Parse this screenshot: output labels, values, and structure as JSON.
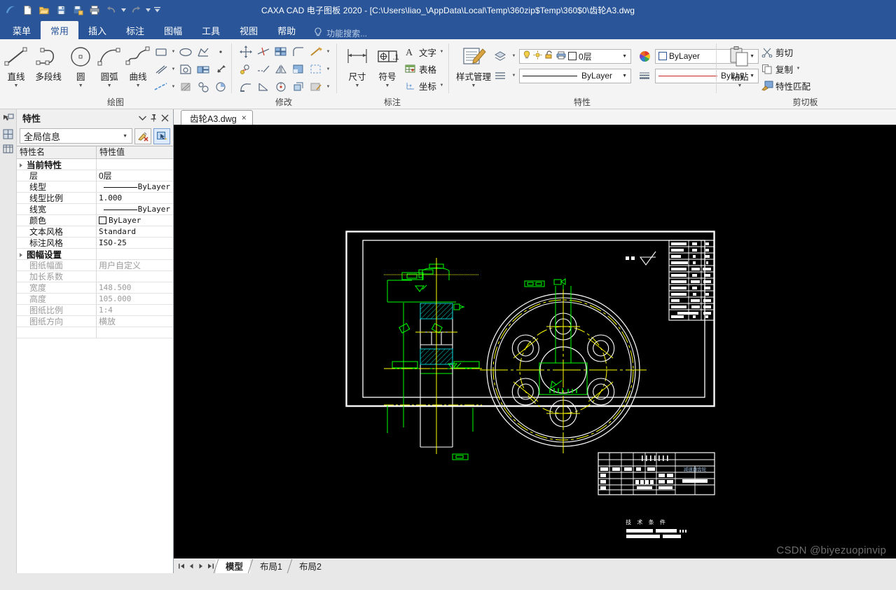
{
  "app": {
    "title": "CAXA CAD 电子图板 2020 - [C:\\Users\\liao_\\AppData\\Local\\Temp\\360zip$Temp\\360$0\\齿轮A3.dwg",
    "accent": "#2a5699",
    "ribbon_bg": "#f4f4f4",
    "canvas_bg": "#000000"
  },
  "quick_access": [
    {
      "name": "new-file-icon",
      "label": "新建"
    },
    {
      "name": "open-file-icon",
      "label": "打开"
    },
    {
      "name": "save-icon",
      "label": "保存"
    },
    {
      "name": "save-as-icon",
      "label": "另存为"
    },
    {
      "name": "print-icon",
      "label": "打印"
    },
    {
      "name": "undo-icon",
      "label": "撤销"
    },
    {
      "name": "redo-icon",
      "label": "恢复"
    },
    {
      "name": "customize-qat-icon",
      "label": "自定义快速启动工具栏"
    }
  ],
  "ribbon_tabs": [
    {
      "label": "菜单",
      "active": false
    },
    {
      "label": "常用",
      "active": true
    },
    {
      "label": "插入",
      "active": false
    },
    {
      "label": "标注",
      "active": false
    },
    {
      "label": "图幅",
      "active": false
    },
    {
      "label": "工具",
      "active": false
    },
    {
      "label": "视图",
      "active": false
    },
    {
      "label": "帮助",
      "active": false
    }
  ],
  "ribbon_search": {
    "placeholder": "功能搜索...",
    "icon": "lightbulb-icon"
  },
  "ribbon_groups": {
    "draw": {
      "title": "绘图",
      "big_buttons": [
        {
          "label": "直线",
          "icon": "line-icon",
          "has_caret": true
        },
        {
          "label": "多段线",
          "icon": "polyline-icon",
          "has_caret": false
        },
        {
          "label": "圆",
          "icon": "circle-icon",
          "has_caret": true
        },
        {
          "label": "圆弧",
          "icon": "arc-icon",
          "has_caret": true
        },
        {
          "label": "曲线",
          "icon": "spline-icon",
          "has_caret": true
        }
      ],
      "small_buttons": [
        "rectangle-icon",
        "ellipse-icon",
        "polygon-icon",
        "point-icon",
        "parallel-line-icon",
        "hatch-region-icon",
        "table-grid-icon",
        "arrow-icon",
        "centerline-icon",
        "hatch-icon",
        "puzzle-icon",
        "pie-icon"
      ]
    },
    "modify": {
      "title": "修改",
      "small_buttons": [
        "move-icon",
        "trim-icon",
        "array-icon",
        "fillet-icon",
        "explode-icon",
        "rotate-icon",
        "extend-icon",
        "mirror-icon",
        "chamfer-icon",
        "offset-icon",
        "stretch-icon",
        "break-icon",
        "scale-icon",
        "copy-3d-icon",
        "edit-hatch-icon"
      ]
    },
    "annotate": {
      "title": "标注",
      "big_buttons": [
        {
          "label": "尺寸",
          "icon": "dimension-icon",
          "has_caret": true
        },
        {
          "label": "符号",
          "icon": "symbol-icon",
          "has_caret": true
        }
      ],
      "text_buttons": [
        {
          "label": "文字",
          "icon": "text-a-icon",
          "has_caret": true
        },
        {
          "label": "表格",
          "icon": "table-icon",
          "has_caret": false
        },
        {
          "label": "坐标",
          "icon": "coordinate-icon",
          "has_caret": true
        }
      ]
    },
    "properties": {
      "title": "特性",
      "style_manager": {
        "label": "样式管理",
        "icon": "style-manager-icon",
        "has_caret": true
      },
      "layer_icon": "layer-icon",
      "linetype_icon": "linetype-list-icon",
      "color_wheel_icon": "color-wheel-icon",
      "lineweight_icon": "lineweight-icon",
      "layer_combo": {
        "value": "0层",
        "icons": [
          "bulb-icon",
          "sun-icon",
          "lock-icon",
          "printer-icon",
          "color-box-icon"
        ]
      },
      "color_combo": {
        "value": "ByLayer",
        "swatch": "#ffffff"
      },
      "linetype_combo": {
        "value": "ByLayer"
      },
      "lineweight_combo": {
        "value": "ByLay",
        "color": "#cc2222"
      }
    },
    "clipboard": {
      "title": "剪切板",
      "paste": {
        "label": "粘贴",
        "icon": "paste-icon",
        "has_caret": true
      },
      "items": [
        {
          "label": "剪切",
          "icon": "scissors-icon",
          "has_caret": false
        },
        {
          "label": "复制",
          "icon": "copy-icon",
          "has_caret": true
        },
        {
          "label": "特性匹配",
          "icon": "match-properties-icon",
          "has_caret": false
        }
      ]
    }
  },
  "vertical_strip": [
    "pick-tool-icon",
    "layer-tool-icon",
    "block-tool-icon"
  ],
  "properties_panel": {
    "title": "特性",
    "header_buttons": [
      "chevron-down-icon",
      "pin-icon",
      "close-icon"
    ],
    "filter": {
      "value": "全局信息"
    },
    "filter_buttons": [
      "clear-selection-icon",
      "select-objects-icon"
    ],
    "columns": {
      "name": "特性名",
      "value": "特性值"
    },
    "groups": [
      {
        "label": "当前特性",
        "dim": false,
        "rows": [
          {
            "name": "层",
            "value": "0层",
            "kind": "cn"
          },
          {
            "name": "线型",
            "value": "ByLayer",
            "kind": "line"
          },
          {
            "name": "线型比例",
            "value": "1.000",
            "kind": "mono"
          },
          {
            "name": "线宽",
            "value": "ByLayer",
            "kind": "line"
          },
          {
            "name": "颜色",
            "value": "ByLayer",
            "kind": "color",
            "swatch": "#ffffff"
          },
          {
            "name": "文本风格",
            "value": "Standard",
            "kind": "mono"
          },
          {
            "name": "标注风格",
            "value": "ISO-25",
            "kind": "mono"
          }
        ]
      },
      {
        "label": "图幅设置",
        "dim": true,
        "rows": [
          {
            "name": "图纸幅面",
            "value": "用户自定义",
            "kind": "cn"
          },
          {
            "name": "加长系数",
            "value": "",
            "kind": "cn"
          },
          {
            "name": "宽度",
            "value": "148.500",
            "kind": "mono"
          },
          {
            "name": "高度",
            "value": "105.000",
            "kind": "mono"
          },
          {
            "name": "图纸比例",
            "value": "1:4",
            "kind": "mono"
          },
          {
            "name": "图纸方向",
            "value": "横放",
            "kind": "cn"
          }
        ]
      }
    ]
  },
  "document_tabs": [
    {
      "label": "齿轮A3.dwg",
      "close": "×",
      "active": true
    }
  ],
  "layout_bar": {
    "nav_buttons": [
      "first-icon",
      "prev-icon",
      "next-icon",
      "last-icon"
    ],
    "tabs": [
      {
        "label": "模型",
        "active": true
      },
      {
        "label": "布局1",
        "active": false
      },
      {
        "label": "布局2",
        "active": false
      }
    ]
  },
  "drawing": {
    "description": "齿轮 A3 工程图 — 剖视图与主视图",
    "annotations": {
      "tech_conditions": "技 术 条 件",
      "roughness_note": "其余",
      "title_block_part": "减速器齿轮"
    },
    "colors": {
      "border": "#ffffff",
      "outline": "#ffffff",
      "construction": "#00ff00",
      "centerline": "#ffff00",
      "hatch": "#00c8c8"
    }
  },
  "watermark": {
    "text": "CSDN @biyezuopinvip"
  }
}
